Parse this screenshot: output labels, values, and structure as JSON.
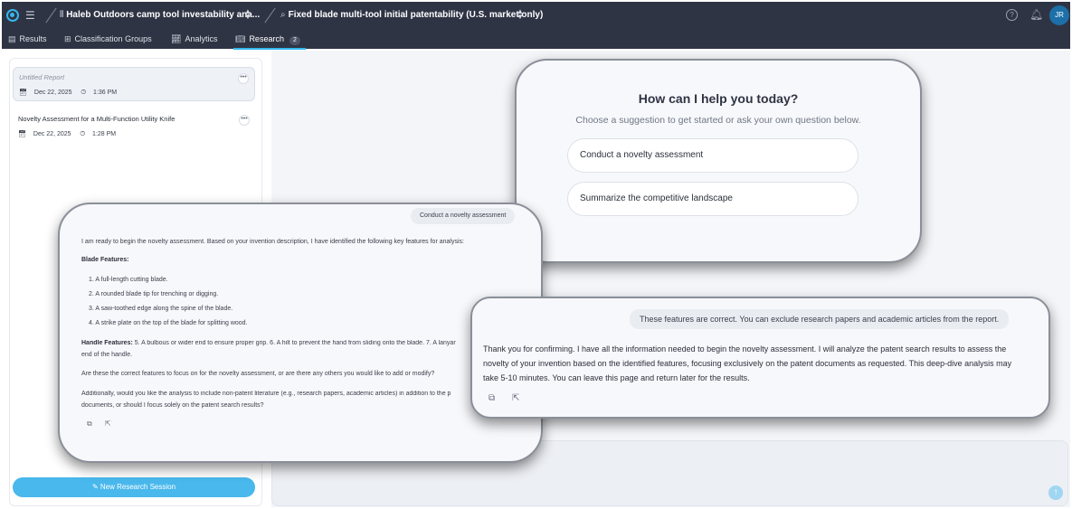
{
  "header": {
    "project_title": "Haleb Outdoors camp tool investability ana...",
    "analysis_title": "Fixed blade multi-tool initial patentability (U.S. market only)",
    "avatar_initials": "JR"
  },
  "tabs": [
    {
      "label": "Results"
    },
    {
      "label": "Classification Groups"
    },
    {
      "label": "Analytics"
    },
    {
      "label": "Research",
      "badge": "2"
    }
  ],
  "sidebar": {
    "reports": [
      {
        "title": "Untitled Report",
        "date": "Dec 22, 2025",
        "time": "1:36 PM"
      },
      {
        "title": "Novelty Assessment for a Multi-Function Utility Knife",
        "date": "Dec 22, 2025",
        "time": "1:28 PM"
      }
    ],
    "new_session_label": "New Research Session"
  },
  "help": {
    "title": "How can I help you today?",
    "subtitle": "Choose a suggestion to get started or ask your own question below.",
    "suggestions": [
      "Conduct a novelty assessment",
      "Summarize the competitive landscape"
    ]
  },
  "chat": {
    "user_message": "Conduct a novelty assessment",
    "intro": "I am ready to begin the novelty assessment. Based on your invention description, I have identified the following key features for analysis:",
    "blade_heading": "Blade Features:",
    "blade_features": [
      "1.  A full-length cutting blade.",
      "2.  A rounded blade tip for trenching or digging.",
      "3.  A saw-toothed edge along the spine of the blade.",
      "4.  A strike plate on the top of the blade for splitting wood."
    ],
    "handle_heading": "Handle Features:",
    "handle_text": "5. A bulbous or wider end to ensure proper grip. 6. A hilt to prevent the hand from sliding onto the blade. 7. A lanyar",
    "handle_text_2": "end of the handle.",
    "question": "Are these the correct features to focus on for the novelty assessment, or are there any others you would like to add or modify?",
    "additional_1": "Additionally, would you like the analysis to include non-patent literature (e.g., research papers, academic articles) in addition to the p",
    "additional_2": "documents, or should I focus solely on the patent search results?"
  },
  "confirm": {
    "user_message": "These features are correct. You can exclude research papers and academic articles from the report.",
    "response": "Thank you for confirming. I have all the information needed to begin the novelty assessment. I will analyze the patent search results to assess the novelty of your invention based on the identified features, focusing exclusively on the patent documents as requested. This deep-dive analysis may take 5-10 minutes. You can leave this page and return later for the results."
  },
  "colors": {
    "topbar": "#2f3444",
    "accent": "#35b7ee",
    "button": "#49b8ec"
  }
}
